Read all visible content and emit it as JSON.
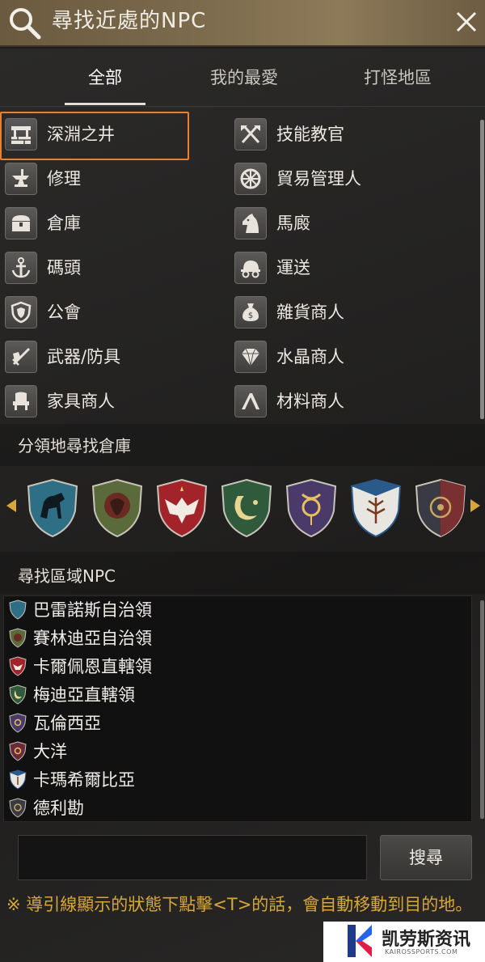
{
  "header": {
    "title": "尋找近處的NPC"
  },
  "tabs": [
    {
      "label": "全部",
      "active": true
    },
    {
      "label": "我的最愛",
      "active": false
    },
    {
      "label": "打怪地區",
      "active": false
    }
  ],
  "npc_categories": [
    {
      "label": "深淵之井",
      "icon": "well-icon",
      "selected": true
    },
    {
      "label": "技能教官",
      "icon": "crossed-axes-icon"
    },
    {
      "label": "修理",
      "icon": "anvil-icon"
    },
    {
      "label": "貿易管理人",
      "icon": "wheel-icon"
    },
    {
      "label": "倉庫",
      "icon": "chest-icon"
    },
    {
      "label": "馬廄",
      "icon": "horse-head-icon"
    },
    {
      "label": "碼頭",
      "icon": "anchor-icon"
    },
    {
      "label": "運送",
      "icon": "wagon-icon"
    },
    {
      "label": "公會",
      "icon": "guild-shield-icon"
    },
    {
      "label": "雜貨商人",
      "icon": "money-bag-icon"
    },
    {
      "label": "武器/防具",
      "icon": "sword-shield-icon"
    },
    {
      "label": "水晶商人",
      "icon": "crystal-icon"
    },
    {
      "label": "家具商人",
      "icon": "chair-icon"
    },
    {
      "label": "材料商人",
      "icon": "pickaxe-icon"
    }
  ],
  "storage_section": {
    "title": "分領地尋找倉庫"
  },
  "territory_crests": [
    {
      "name": "balenos-crest",
      "color": "#2e6f86"
    },
    {
      "name": "serendia-crest",
      "color": "#5a6a3a"
    },
    {
      "name": "calpheon-crest",
      "color": "#a3232a"
    },
    {
      "name": "mediah-crest",
      "color": "#2f5a3c"
    },
    {
      "name": "valencia-crest",
      "color": "#4a3a6a"
    },
    {
      "name": "kamasylvia-crest",
      "color": "#2a5a8a"
    },
    {
      "name": "drieghan-crest",
      "color": "#3a3a44"
    }
  ],
  "region_section": {
    "title": "尋找區域NPC"
  },
  "regions": [
    {
      "name": "巴雷諾斯自治領",
      "color": "#2e6f86"
    },
    {
      "name": "賽林迪亞自治領",
      "color": "#5a6a3a"
    },
    {
      "name": "卡爾佩恩直轄領",
      "color": "#a3232a"
    },
    {
      "name": "梅迪亞直轄領",
      "color": "#2f5a3c"
    },
    {
      "name": "瓦倫西亞",
      "color": "#4a3a6a"
    },
    {
      "name": "大洋",
      "color": "#6a2a3a"
    },
    {
      "name": "卡瑪希爾比亞",
      "color": "#2a5a8a"
    },
    {
      "name": "德利勘",
      "color": "#3a3a44"
    }
  ],
  "search": {
    "value": "",
    "button_label": "搜尋"
  },
  "notice": "※ 導引線顯示的狀態下點擊<T>的話，會自動移動到目的地。",
  "watermark": {
    "text": "凯劳斯资讯",
    "sub": "KAIROSSPORTS.COM"
  },
  "colors": {
    "accent": "#e8812f",
    "notice": "#d9a735",
    "arrow": "#d7a73c"
  }
}
